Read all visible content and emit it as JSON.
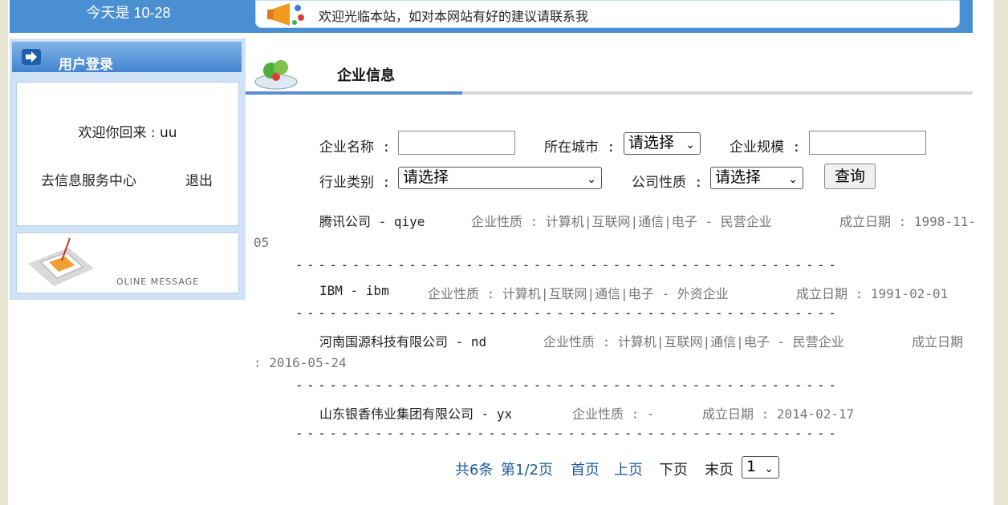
{
  "header": {
    "date": "今天是 10-28",
    "notice": "欢迎光临本站，如对本网站有好的建议请联系我"
  },
  "sidebar": {
    "login_title": "用户登录",
    "welcome": "欢迎你回来 : uu",
    "service_link": "去信息服务中心",
    "logout_link": "退出",
    "message_caption": "OLINE MESSAGE"
  },
  "main": {
    "title": "企业信息",
    "search": {
      "name_label": "企业名称 :",
      "city_label": "所在城市 :",
      "city_value": "请选择",
      "scale_label": "企业规模 :",
      "industry_label": "行业类别 :",
      "industry_value": "请选择",
      "nature_label": "公司性质 :",
      "nature_value": "请选择",
      "query_button": "查询"
    },
    "companies": [
      {
        "name": "腾讯公司 - qiye",
        "nature": "企业性质 : 计算机|互联网|通信|电子 - 民营企业",
        "date_part1": "成立日期 : 1998-11-",
        "date_part2": "05"
      },
      {
        "name": "IBM - ibm",
        "nature": "企业性质 : 计算机|互联网|通信|电子 - 外资企业",
        "date_part1": "成立日期 : 1991-02-01"
      },
      {
        "name": "河南国源科技有限公司 - nd",
        "nature": "企业性质 : 计算机|互联网|通信|电子 - 民营企业",
        "date_part1": "成立日期",
        "date_part2": ": 2016-05-24"
      },
      {
        "name": "山东银香伟业集团有限公司 - yx",
        "nature": "企业性质 : -",
        "date_part1": "成立日期 : 2014-02-17"
      }
    ],
    "divider": "------------------------------------------------",
    "pager": {
      "total": "共6条",
      "page": "第1/2页",
      "first": "首页",
      "prev": "上页",
      "next": "下页",
      "last": "末页",
      "page_select": "1"
    }
  }
}
